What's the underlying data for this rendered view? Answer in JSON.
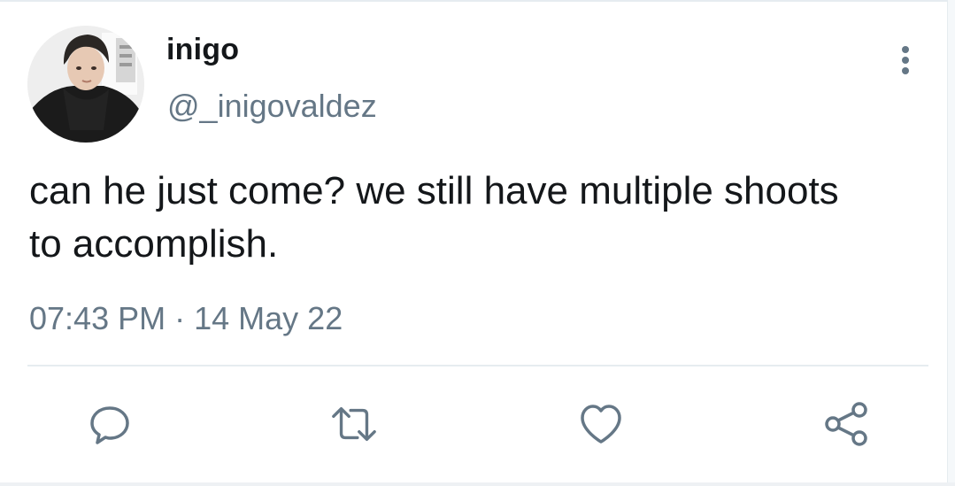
{
  "tweet": {
    "author": {
      "display_name": "inigo",
      "handle": "@_inigovaldez",
      "avatar_icon": "profile-photo"
    },
    "text": "can he just come? we still have multiple shoots to accomplish.",
    "time": "07:43 PM",
    "separator": "·",
    "date": "14 May 22"
  },
  "menu": {
    "icon": "more-vertical-icon"
  },
  "actions": [
    {
      "icon": "reply-icon"
    },
    {
      "icon": "retweet-icon"
    },
    {
      "icon": "like-icon"
    },
    {
      "icon": "share-icon"
    }
  ],
  "colors": {
    "text_primary": "#14171a",
    "text_secondary": "#657786",
    "divider": "#e6ecf0"
  }
}
